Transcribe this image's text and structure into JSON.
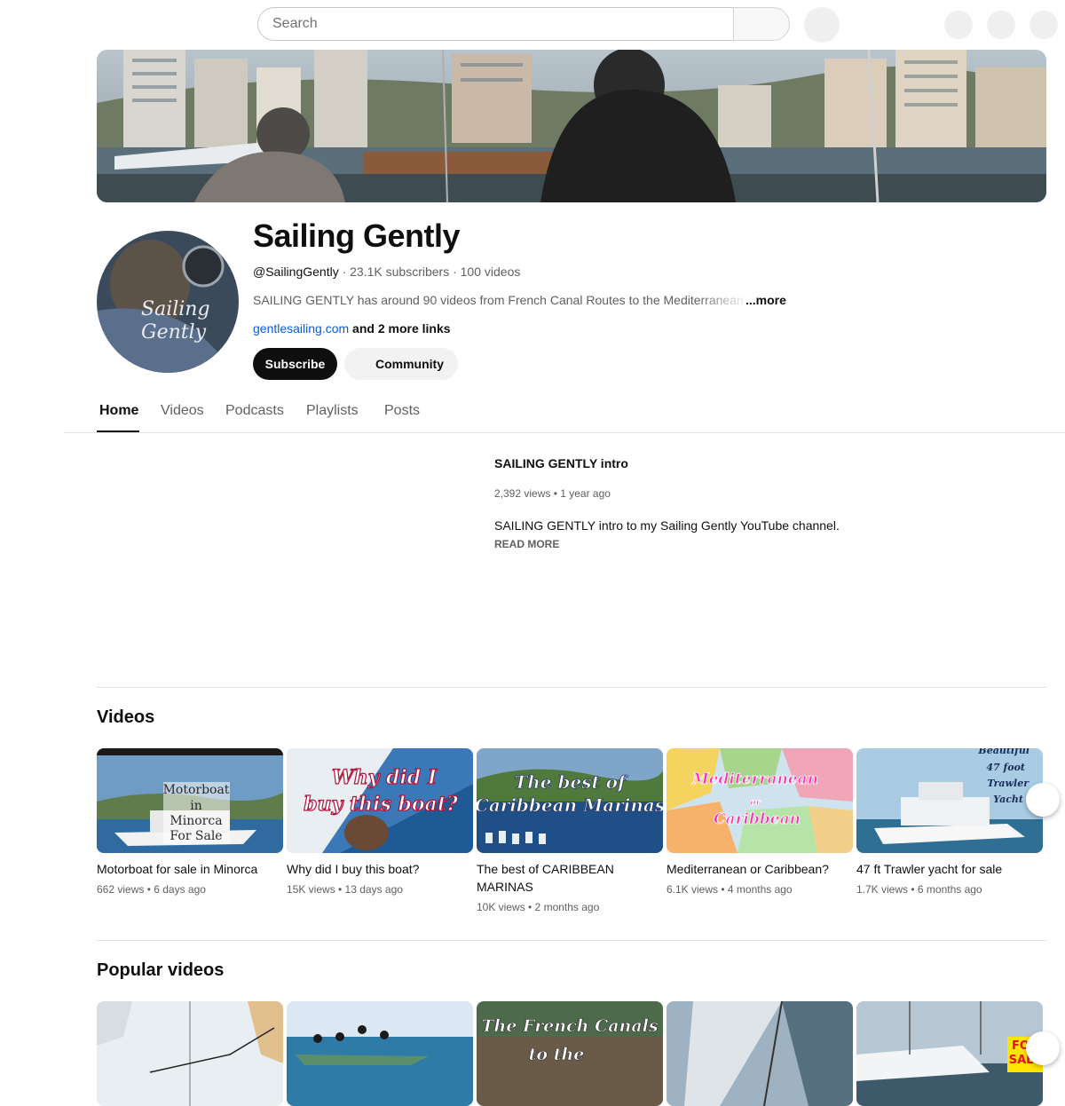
{
  "search": {
    "placeholder": "Search"
  },
  "channel": {
    "name": "Sailing Gently",
    "handle": "@SailingGently",
    "stats": " · 23.1K subscribers · 100 videos",
    "description": "SAILING GENTLY has around 90 videos from French Canal Routes to the Mediterranean w",
    "more_label": "...more",
    "link_url": "gentlesailing.com",
    "link_extra": " and 2 more links",
    "avatar_text_line1": "Sailing",
    "avatar_text_line2": "Gently",
    "subscribe_label": "Subscribe",
    "community_label": "Community"
  },
  "tabs": [
    {
      "label": "Home"
    },
    {
      "label": "Videos"
    },
    {
      "label": "Podcasts"
    },
    {
      "label": "Playlists"
    },
    {
      "label": "Posts"
    }
  ],
  "featured": {
    "title": "SAILING GENTLY intro",
    "meta": "2,392 views • 1 year ago",
    "description": "SAILING GENTLY intro to my Sailing Gently YouTube channel.",
    "read_more": "READ MORE"
  },
  "videos_section": {
    "title": "Videos",
    "items": [
      {
        "title": "Motorboat for sale in Minorca",
        "meta": "662 views • 6 days ago",
        "thumb_text": [
          "Motorboat",
          "in",
          "Minorca",
          "For Sale"
        ]
      },
      {
        "title": "Why did I buy this boat?",
        "meta": "15K views • 13 days ago",
        "thumb_text": [
          "Why did I",
          "buy this boat?"
        ]
      },
      {
        "title": "The best of CARIBBEAN MARINAS",
        "meta": "10K views • 2 months ago",
        "thumb_text": [
          "The best of",
          "Caribbean Marinas"
        ]
      },
      {
        "title": "Mediterranean or Caribbean?",
        "meta": "6.1K views • 4 months ago",
        "thumb_text": [
          "Mediterranean",
          "or",
          "Caribbean"
        ]
      },
      {
        "title": "47 ft Trawler yacht for sale",
        "meta": "1.7K views • 6 months ago",
        "thumb_text": [
          "Beautiful",
          "47 foot",
          "Trawler",
          "Yacht"
        ]
      }
    ]
  },
  "popular_section": {
    "title": "Popular videos",
    "items": [
      {
        "thumb_text": []
      },
      {
        "thumb_text": []
      },
      {
        "thumb_text": [
          "The French Canals",
          "to the"
        ]
      },
      {
        "thumb_text": []
      },
      {
        "thumb_text": [
          "FOR",
          "SALE"
        ]
      }
    ]
  }
}
